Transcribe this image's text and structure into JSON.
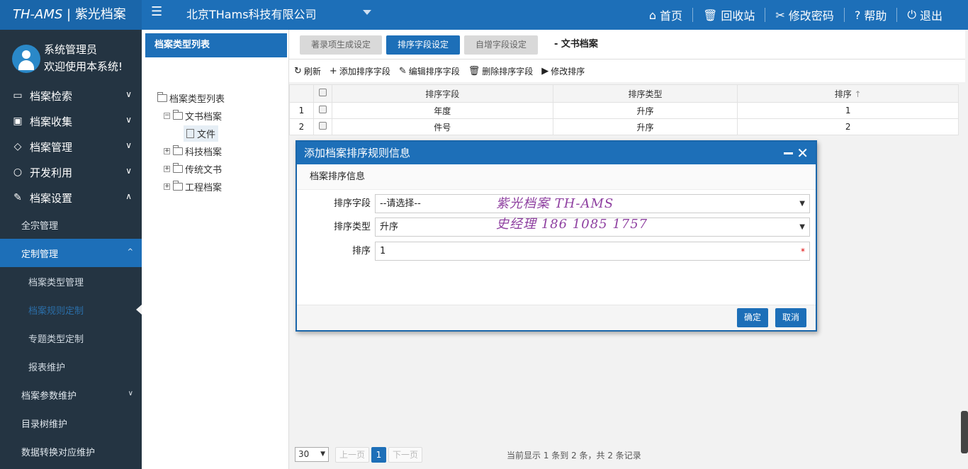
{
  "app": {
    "logo_en": "TH-AMS",
    "logo_cn": "紫光档案",
    "company": "北京THams科技有限公司"
  },
  "topnav": [
    {
      "icon": "home-icon",
      "glyph": "⌂",
      "label": "首页"
    },
    {
      "icon": "trash-icon",
      "glyph": "🗑",
      "label": "回收站"
    },
    {
      "icon": "tools-icon",
      "glyph": "✂",
      "label": "修改密码"
    },
    {
      "icon": "help-icon",
      "glyph": "?",
      "label": "帮助"
    },
    {
      "icon": "power-icon",
      "glyph": "⏻",
      "label": "退出"
    }
  ],
  "user": {
    "name": "系统管理员",
    "welcome": "欢迎使用本系统!"
  },
  "sidebar": {
    "l1": [
      {
        "label": "档案检索",
        "chev": "∨"
      },
      {
        "label": "档案收集",
        "chev": "∨"
      },
      {
        "label": "档案管理",
        "chev": "∨"
      },
      {
        "label": "开发利用",
        "chev": "∨"
      },
      {
        "label": "档案设置",
        "chev": "∧"
      }
    ],
    "sub": {
      "qz": "全宗管理",
      "custom": "定制管理",
      "custom_chev": "^"
    },
    "l3": [
      "档案类型管理",
      "档案规则定制",
      "专题类型定制",
      "报表维护"
    ],
    "after": {
      "params": "档案参数维护",
      "params_chev": "∨",
      "tree": "目录树维护",
      "convert": "数据转换对应维护"
    }
  },
  "tree": {
    "header": "档案类型列表",
    "root": "档案类型列表",
    "n1": "文书档案",
    "n1c": "文件",
    "n2": "科技档案",
    "n3": "传统文书",
    "n4": "工程档案",
    "minus": "−",
    "plus": "+"
  },
  "tabs": {
    "t1": "著录项生成设定",
    "t2": "排序字段设定",
    "t3": "自增字段设定",
    "title": "- 文书档案"
  },
  "toolbar": {
    "refresh": "刷新",
    "refresh_glyph": "↻",
    "add": "添加排序字段",
    "add_glyph": "+",
    "edit": "编辑排序字段",
    "edit_glyph": "✎",
    "del": "删除排序字段",
    "del_glyph": "🗑",
    "modify": "修改排序",
    "modify_glyph": "▶"
  },
  "grid": {
    "cols": [
      "排序字段",
      "排序类型",
      "排序"
    ],
    "sort_glyph": "↑",
    "rows": [
      {
        "no": "1",
        "field": "年度",
        "type": "升序",
        "order": "1"
      },
      {
        "no": "2",
        "field": "件号",
        "type": "升序",
        "order": "2"
      }
    ]
  },
  "pager": {
    "size": "30",
    "prev": "上一页",
    "page": "1",
    "next": "下一页",
    "info": "当前显示 1 条到 2 条，共 2 条记录"
  },
  "dialog": {
    "title": "添加档案排序规则信息",
    "section": "档案排序信息",
    "f1_label": "排序字段",
    "f1_value": "--请选择--",
    "f2_label": "排序类型",
    "f2_value": "升序",
    "f3_label": "排序",
    "f3_value": "1",
    "ok": "确定",
    "cancel": "取消"
  },
  "watermark": {
    "l1": "紫光档案 TH-AMS",
    "l2": "史经理 186 1085 1757"
  }
}
